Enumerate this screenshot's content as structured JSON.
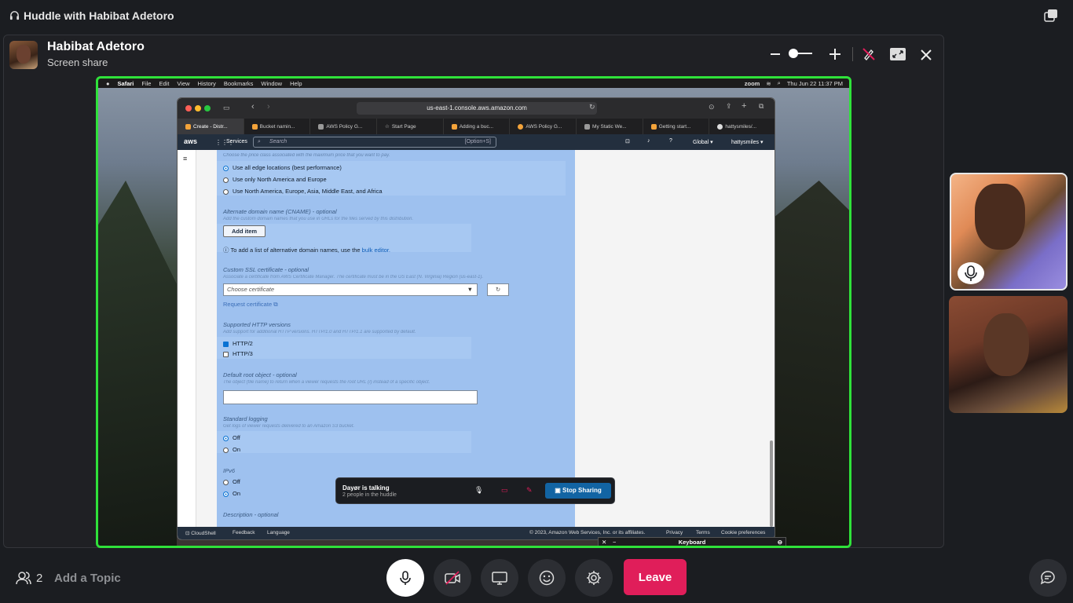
{
  "huddle": {
    "title": "Huddle with Habibat Adetoro"
  },
  "presenter": {
    "name": "Habibat Adetoro",
    "subtitle": "Screen share"
  },
  "mac_menubar": {
    "app": "Safari",
    "items": [
      "File",
      "Edit",
      "View",
      "History",
      "Bookmarks",
      "Window",
      "Help"
    ],
    "zoom": "zoom",
    "clock": "Thu Jun 22  11:37 PM"
  },
  "browser": {
    "url": "us-east-1.console.aws.amazon.com",
    "tabs": [
      "Create - Distr...",
      "Bucket namin...",
      "AWS Policy G...",
      "Start Page",
      "Adding a buc...",
      "AWS Policy G...",
      "My Static We...",
      "Getting start...",
      "hattysmiles/..."
    ]
  },
  "aws": {
    "logo": "aws",
    "services": "Services",
    "search_placeholder": "Search",
    "search_shortcut": "[Option+S]",
    "region": "Global",
    "account": "hattysmiles"
  },
  "form": {
    "price_class_hint": "Choose the price class associated with the maximum price that you want to pay.",
    "price_options": [
      "Use all edge locations (best performance)",
      "Use only North America and Europe",
      "Use North America, Europe, Asia, Middle East, and Africa"
    ],
    "cname_label": "Alternate domain name (CNAME) - optional",
    "cname_hint": "Add the custom domain names that you use in URLs for the files served by this distribution.",
    "add_item": "Add item",
    "bulk_text": "To add a list of alternative domain names, use the",
    "bulk_link": "bulk editor.",
    "ssl_label": "Custom SSL certificate - optional",
    "ssl_hint": "Associate a certificate from AWS Certificate Manager. The certificate must be in the US East (N. Virginia) Region (us-east-1).",
    "ssl_placeholder": "Choose certificate",
    "request_cert": "Request certificate",
    "http_label": "Supported HTTP versions",
    "http_hint": "Add support for additional HTTP versions. HTTP/1.0 and HTTP/1.1 are supported by default.",
    "http_options": [
      "HTTP/2",
      "HTTP/3"
    ],
    "root_label": "Default root object - optional",
    "root_hint": "The object (file name) to return when a viewer requests the root URL (/) instead of a specific object.",
    "logging_label": "Standard logging",
    "logging_hint": "Get logs of viewer requests delivered to an Amazon S3 bucket.",
    "logging_options": [
      "Off",
      "On"
    ],
    "ipv6_label": "IPv6",
    "ipv6_options": [
      "Off",
      "On"
    ],
    "desc_label": "Description - optional"
  },
  "aws_footer": {
    "cloudshell": "CloudShell",
    "feedback": "Feedback",
    "language": "Language",
    "copyright": "© 2023, Amazon Web Services, Inc. or its affiliates.",
    "privacy": "Privacy",
    "terms": "Terms",
    "cookies": "Cookie preferences"
  },
  "huddle_popup": {
    "talking": "Dayør is talking",
    "people": "2 people in the huddle",
    "stop_sharing": "Stop Sharing"
  },
  "keyboard_viewer": {
    "title": "Keyboard"
  },
  "bottom": {
    "people_count": "2",
    "add_topic": "Add a Topic",
    "leave": "Leave"
  },
  "colors": {
    "share_border": "#2fe23a",
    "leave": "#e01e5a",
    "stop_sharing": "#1264a3"
  }
}
